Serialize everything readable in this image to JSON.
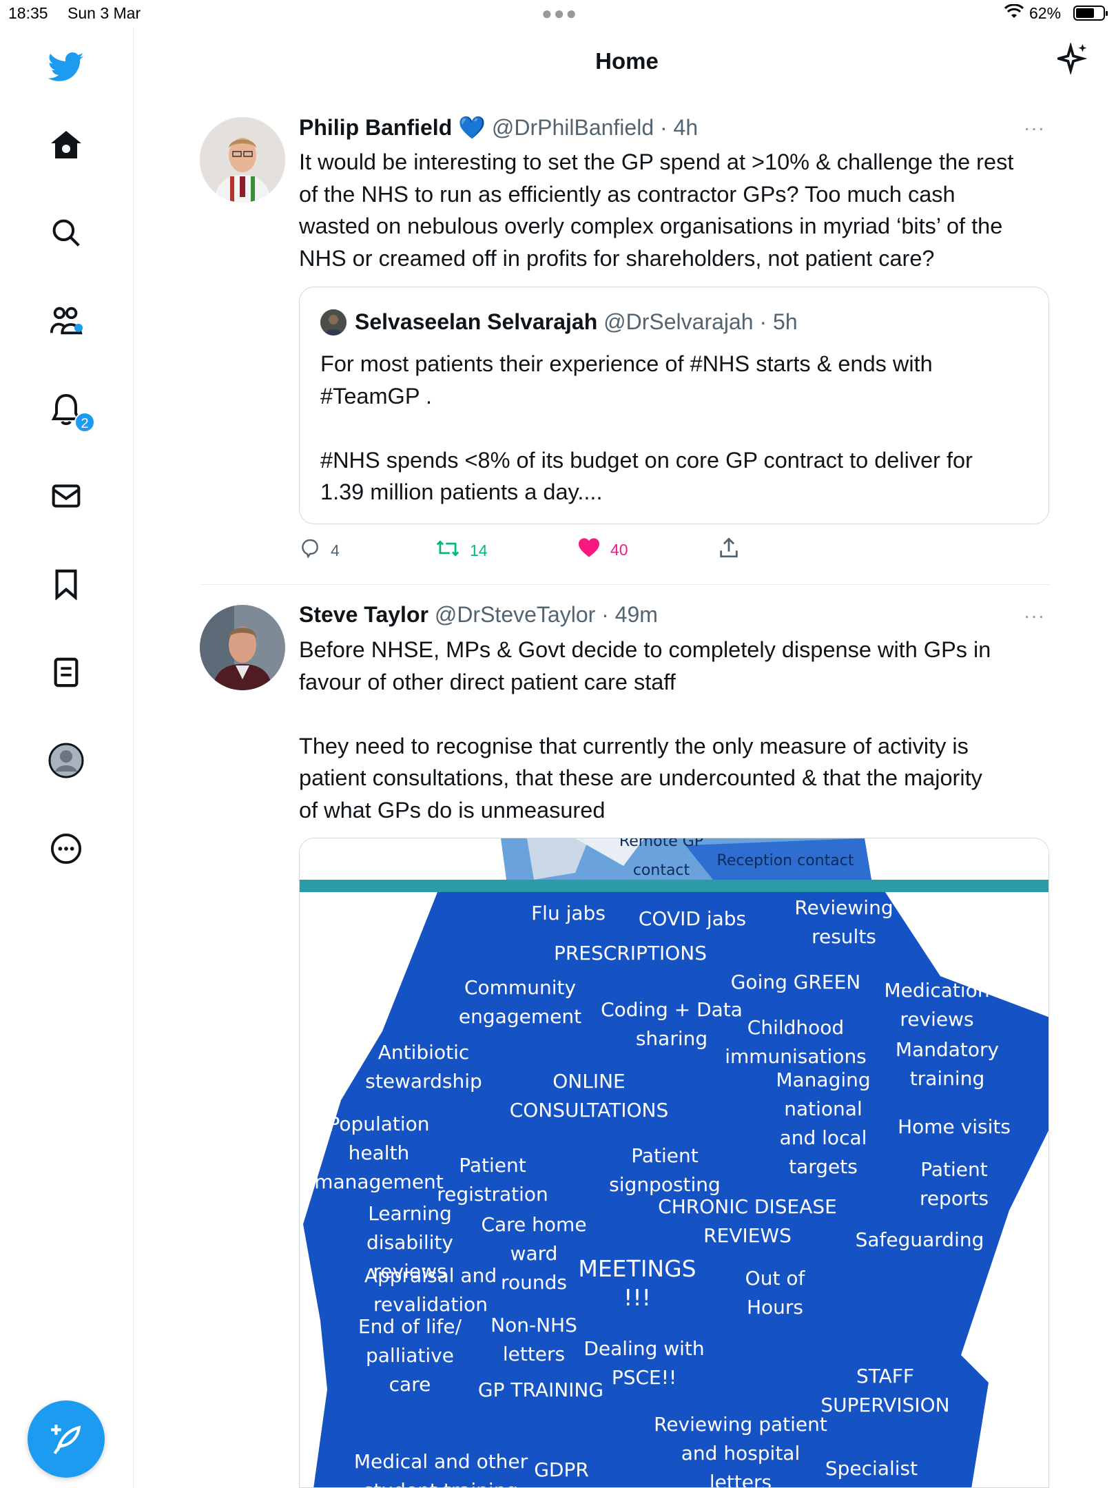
{
  "status_bar": {
    "time": "18:35",
    "date": "Sun 3 Mar",
    "battery": "62%"
  },
  "header": {
    "title": "Home"
  },
  "sidebar": {
    "notification_badge": "2"
  },
  "tweets": [
    {
      "name": "Philip Banfield",
      "verified_emoji": "💙",
      "handle": "@DrPhilBanfield",
      "time": "· 4h",
      "more": "···",
      "text": "It would be interesting to set the GP spend at >10% & challenge the rest\nof the NHS to run as efficiently as contractor GPs? Too much cash\nwasted on nebulous overly complex organisations in myriad ‘bits’ of the\nNHS or creamed off in profits for shareholders, not patient care?",
      "quote": {
        "name": "Selvaseelan Selvarajah",
        "handle": "@DrSelvarajah",
        "time": "· 5h",
        "text": "For most patients their experience of #NHS starts & ends with\n#TeamGP  .\n\n#NHS spends <8% of its budget on core GP contract to deliver for\n1.39 million patients a day...."
      },
      "replies": "4",
      "retweets": "14",
      "likes": "40"
    },
    {
      "name": "Steve Taylor",
      "handle": "@DrSteveTaylor",
      "time": "· 49m",
      "more": "···",
      "text": "Before NHSE, MPs & Govt decide to completely dispense with GPs in\nfavour of other direct patient care staff\n\nThey need to recognise that currently the only measure of activity is\npatient consultations, that these are undercounted & that the majority\nof what GPs do is unmeasured"
    }
  ],
  "iceberg": {
    "above_water": [
      "Remote GP contact",
      "Reception contact"
    ],
    "words": [
      "Flu jabs",
      "COVID jabs",
      "Reviewing\nresults",
      "PRESCRIPTIONS",
      "Community\nengagement",
      "Coding + Data\nsharing",
      "Going GREEN",
      "Medication\nreviews",
      "Childhood\nimmunisations",
      "Antibiotic\nstewardship",
      "Mandatory\ntraining",
      "ONLINE\nCONSULTATIONS",
      "Managing\nnational\nand local\ntargets",
      "Population\nhealth\nmanagement",
      "Home visits",
      "Patient\nregistration",
      "Patient\nsignposting",
      "Patient\nreports",
      "CHRONIC DISEASE\nREVIEWS",
      "Learning\ndisability reviews",
      "Care home\nward\nrounds",
      "Safeguarding",
      "Appraisal and\nrevalidation",
      "MEETINGS\n!!!",
      "Out of\nHours",
      "Non-NHS\nletters",
      "End of life/\npalliative\ncare",
      "Dealing with\nPSCE!!",
      "GP TRAINING",
      "STAFF\nSUPERVISION",
      "Reviewing patient\nand hospital\nletters",
      "Medical and other\nstudent training",
      "GDPR",
      "Specialist\nclinics"
    ]
  },
  "colors": {
    "accent": "#1d9bf0",
    "retweet": "#00ba7c",
    "like": "#f91880",
    "iceberg_blue": "#1552c4",
    "water": "#2a9ca8"
  }
}
